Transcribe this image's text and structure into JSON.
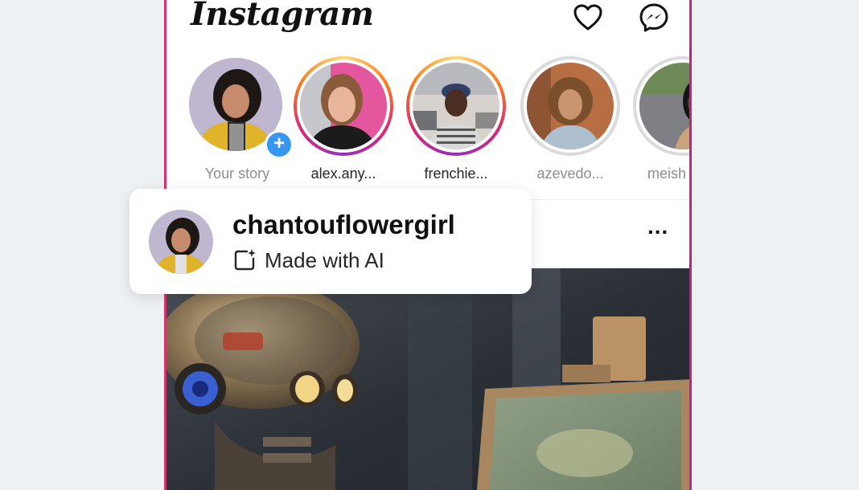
{
  "app": {
    "logo_text": "Instagram",
    "header_icons": [
      "heart-icon",
      "messenger-icon"
    ]
  },
  "stories": [
    {
      "label": "Your story",
      "ring": "none",
      "badge": "+"
    },
    {
      "label": "alex.any...",
      "ring": "active"
    },
    {
      "label": "frenchie...",
      "ring": "active"
    },
    {
      "label": "azevedo...",
      "ring": "seen"
    },
    {
      "label": "meish",
      "ring": "seen"
    }
  ],
  "post": {
    "more_label": "..."
  },
  "popup": {
    "username": "chantouflowergirl",
    "ai_label": "Made with AI",
    "ai_icon": "ai-sparkle-square-icon"
  },
  "colors": {
    "brand_gradient": [
      "#feda75",
      "#fa7e1e",
      "#d62976",
      "#962fbf"
    ],
    "badge_blue": "#3897f0",
    "seen_ring": "#dbdbdb",
    "muted_text": "#8e8e8e"
  }
}
